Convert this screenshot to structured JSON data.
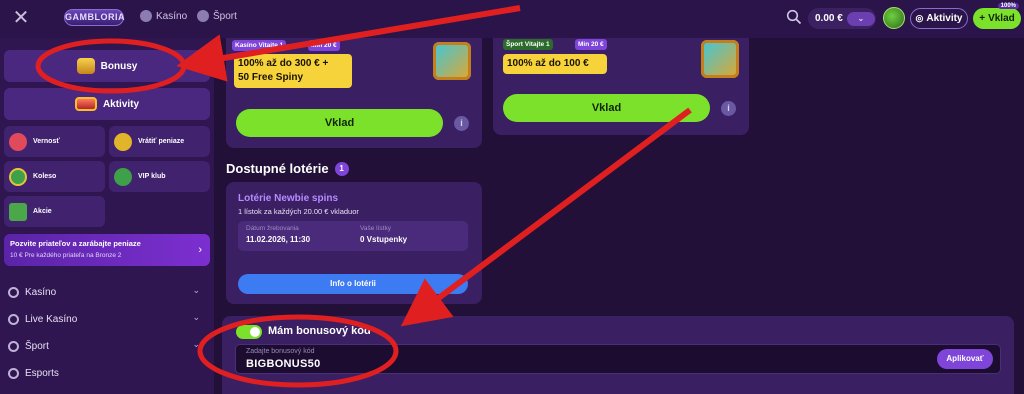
{
  "topbar": {
    "logo": "GAMBLORIA",
    "nav": [
      "Kasíno",
      "Šport"
    ],
    "balance": "0.00 €",
    "aktivity_label": "Aktivity",
    "vklad_label": "Vklad",
    "vklad_badge": "100%"
  },
  "sidebar": {
    "bonusy": "Bonusy",
    "aktivity": "Aktivity",
    "tiles": [
      "Vernosť",
      "Vrátiť peniaze",
      "Koleso",
      "VIP klub",
      "Akcie"
    ],
    "promo_title": "Pozvite priateľov a zarábajte peniaze",
    "promo_sub": "10 € Pre každého priateľa na Bronze 2",
    "menu": [
      "Kasíno",
      "Live Kasíno",
      "Šport",
      "Esports"
    ]
  },
  "offers": [
    {
      "tag": "Kasíno Vitajte 1",
      "tag2": "Min 20 €",
      "line1": "100% až do 300 € +",
      "line2": "50 Free Spiny",
      "button": "Vklad"
    },
    {
      "tag": "Šport Vitajte 1",
      "tag2": "Min 20 €",
      "line1": "100% až do 100 €",
      "button": "Vklad"
    }
  ],
  "lotteries": {
    "title": "Dostupné lotérie",
    "count": "1",
    "name": "Lotérie Newbie spins",
    "desc": "1 lístok za každých 20.00 € vkladuor",
    "date_label": "Dátum žrebovania",
    "date_value": "11.02.2026, 11:30",
    "tickets_label": "Vaše lístky",
    "tickets_value": "0 Vstupenky",
    "button": "Info o lotérii"
  },
  "bonus_code": {
    "toggle_label": "Mám bonusový kód",
    "placeholder": "Zadajte bonusový kód",
    "value": "BIGBONUS50",
    "apply": "Aplikovať"
  },
  "colors": {
    "accent_green": "#7ce12a",
    "accent_purple": "#7e45d8",
    "annotation_red": "#e02020"
  }
}
